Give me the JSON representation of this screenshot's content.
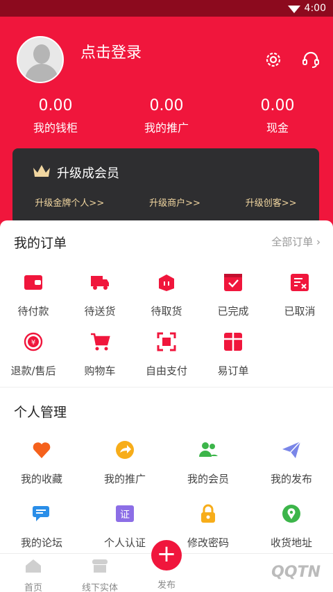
{
  "status": {
    "time": "4:00"
  },
  "profile": {
    "login_label": "点击登录"
  },
  "stats": [
    {
      "value": "0.00",
      "label": "我的钱柜"
    },
    {
      "value": "0.00",
      "label": "我的推广"
    },
    {
      "value": "0.00",
      "label": "现金"
    }
  ],
  "vip": {
    "title": "升级成会员",
    "links": [
      "升级金牌个人>>",
      "升级商户>>",
      "升级创客>>"
    ]
  },
  "orders": {
    "title": "我的订单",
    "all_label": "全部订单",
    "items": [
      "待付款",
      "待送货",
      "待取货",
      "已完成",
      "已取消",
      "退款/售后",
      "购物车",
      "自由支付",
      "易订单"
    ]
  },
  "personal": {
    "title": "个人管理",
    "items": [
      "我的收藏",
      "我的推广",
      "我的会员",
      "我的发布",
      "我的论坛",
      "个人认证",
      "修改密码",
      "收货地址"
    ]
  },
  "tabbar": {
    "items": [
      "首页",
      "线下实体",
      "发布"
    ],
    "watermark": "QQTN"
  },
  "colors": {
    "brand": "#f0163c",
    "vip_bg": "#2e2e30",
    "vip_text": "#f1d6a0"
  }
}
